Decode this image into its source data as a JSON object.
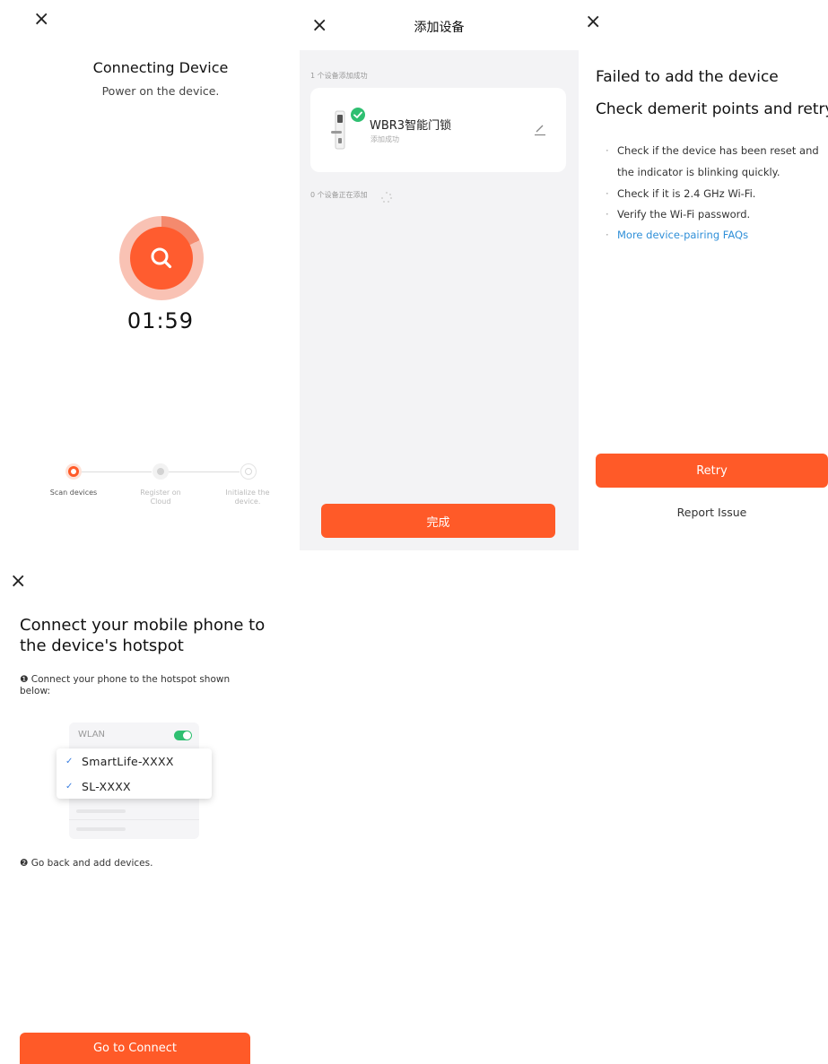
{
  "panel_connecting": {
    "close_icon": "×",
    "title": "Connecting Device",
    "subtitle": "Power on the device.",
    "search_icon": "search-icon",
    "countdown": "01:59",
    "steps": [
      {
        "label": "Scan devices",
        "state": "active"
      },
      {
        "label": "Register on Cloud",
        "state": "pending"
      },
      {
        "label": "Initialize the device.",
        "state": "pending"
      }
    ]
  },
  "panel_add_device": {
    "close_icon": "×",
    "title": "添加设备",
    "success_count_text": "1 个设备添加成功",
    "device": {
      "name": "WBR3智能门锁",
      "status": "添加成功"
    },
    "adding_count_text": "0 个设备正在添加",
    "done_label": "完成"
  },
  "panel_failed": {
    "close_icon": "×",
    "title": "Failed to add the device",
    "subtitle": "Check demerit points and retry",
    "tips": [
      "Check if the device has been reset and",
      "the indicator is blinking quickly.",
      "Check if it is 2.4 GHz Wi-Fi.",
      "Verify the Wi-Fi password."
    ],
    "faq_link": "More device-pairing FAQs",
    "retry_label": "Retry",
    "report_label": "Report Issue"
  },
  "panel_hotspot": {
    "close_icon": "×",
    "title": "Connect your mobile phone to the device's hotspot",
    "step1_num": "❶",
    "step1": "Connect your phone to the hotspot shown below:",
    "wlan_label": "WLAN",
    "networks": [
      "SmartLife-XXXX",
      "SL-XXXX"
    ],
    "step2_num": "❷",
    "step2": "Go back and add devices.",
    "connect_label": "Go to Connect"
  },
  "colors": {
    "accent": "#ff5a28",
    "link": "#2f8fd8",
    "success": "#2fbf71"
  }
}
